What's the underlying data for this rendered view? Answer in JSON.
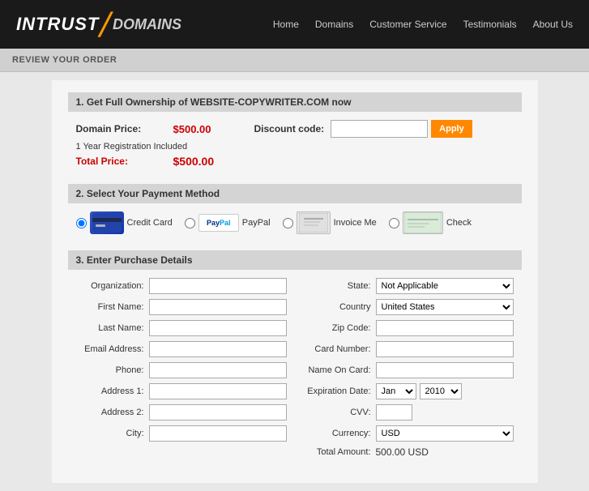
{
  "header": {
    "logo_intrust": "INTRUST",
    "logo_slash": "⟋",
    "logo_domains": "DOMAINS",
    "nav": [
      {
        "label": "Home",
        "href": "#"
      },
      {
        "label": "Domains",
        "href": "#"
      },
      {
        "label": "Customer Service",
        "href": "#"
      },
      {
        "label": "Testimonials",
        "href": "#"
      },
      {
        "label": "About Us",
        "href": "#"
      }
    ]
  },
  "page_title": "REVIEW YOUR ORDER",
  "section1": {
    "heading": "1. Get Full Ownership of WEBSITE-COPYWRITER.COM now",
    "domain_price_label": "Domain Price:",
    "domain_price_value": "$500.00",
    "discount_label": "Discount code:",
    "discount_placeholder": "",
    "apply_btn": "Apply",
    "registration_text": "1 Year Registration Included",
    "total_price_label": "Total Price:",
    "total_price_value": "$500.00"
  },
  "section2": {
    "heading": "2. Select Your Payment Method",
    "options": [
      {
        "id": "cc",
        "label": "Credit Card",
        "icon": "credit-card"
      },
      {
        "id": "paypal",
        "label": "PayPal",
        "icon": "paypal"
      },
      {
        "id": "invoice",
        "label": "Invoice Me",
        "icon": "invoice"
      },
      {
        "id": "check",
        "label": "Check",
        "icon": "check"
      }
    ]
  },
  "section3": {
    "heading": "3. Enter Purchase Details",
    "left_fields": [
      {
        "label": "Organization:",
        "name": "organization"
      },
      {
        "label": "First Name:",
        "name": "first-name"
      },
      {
        "label": "Last Name:",
        "name": "last-name"
      },
      {
        "label": "Email Address:",
        "name": "email"
      },
      {
        "label": "Phone:",
        "name": "phone"
      },
      {
        "label": "Address 1:",
        "name": "address1"
      },
      {
        "label": "Address 2:",
        "name": "address2"
      },
      {
        "label": "City:",
        "name": "city"
      }
    ],
    "right_fields": [
      {
        "label": "State:",
        "type": "select",
        "name": "state",
        "value": "Not Applicable"
      },
      {
        "label": "Country",
        "type": "select",
        "name": "country",
        "value": "United States"
      },
      {
        "label": "Zip Code:",
        "type": "input",
        "name": "zipcode"
      },
      {
        "label": "Card Number:",
        "type": "input",
        "name": "card-number"
      },
      {
        "label": "Name On Card:",
        "type": "input",
        "name": "name-on-card"
      },
      {
        "label": "Expiration Date:",
        "type": "expiry",
        "name": "expiry",
        "month": "Jan",
        "year": "2010"
      },
      {
        "label": "CVV:",
        "type": "cvv",
        "name": "cvv"
      },
      {
        "label": "Currency:",
        "type": "select",
        "name": "currency",
        "value": "USD"
      },
      {
        "label": "Total Amount:",
        "type": "static",
        "name": "total-amount",
        "value": "500.00 USD"
      }
    ]
  }
}
